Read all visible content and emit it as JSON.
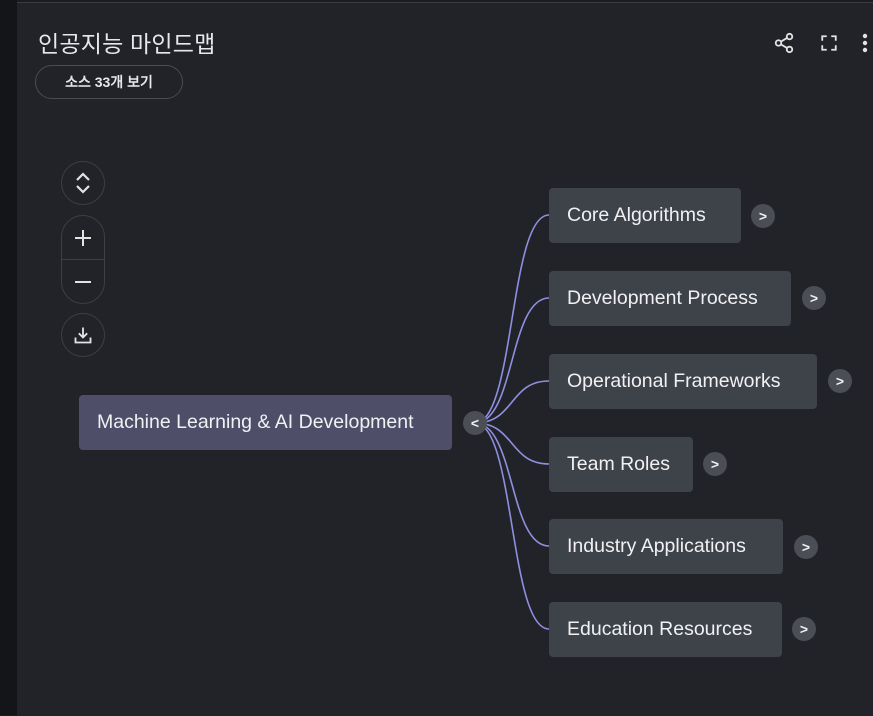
{
  "header": {
    "title": "인공지능 마인드맵",
    "source_button_label": "소스 33개 보기"
  },
  "mindmap": {
    "root": {
      "label": "Machine Learning & AI Development",
      "toggle": "<"
    },
    "children": [
      {
        "label": "Core Algorithms",
        "toggle": ">"
      },
      {
        "label": "Development Process",
        "toggle": ">"
      },
      {
        "label": "Operational Frameworks",
        "toggle": ">"
      },
      {
        "label": "Team Roles",
        "toggle": ">"
      },
      {
        "label": "Industry Applications",
        "toggle": ">"
      },
      {
        "label": "Education Resources",
        "toggle": ">"
      }
    ],
    "colors": {
      "link": "#8f8fe0",
      "root_bg": "#4f4e69",
      "child_bg": "#3e4249"
    }
  },
  "icons": {
    "share": "share-icon",
    "fullscreen": "fullscreen-icon",
    "more": "more-vert-icon",
    "expand_collapse": "unfold-icon",
    "zoom_in": "plus-icon",
    "zoom_out": "minus-icon",
    "download": "download-icon"
  }
}
